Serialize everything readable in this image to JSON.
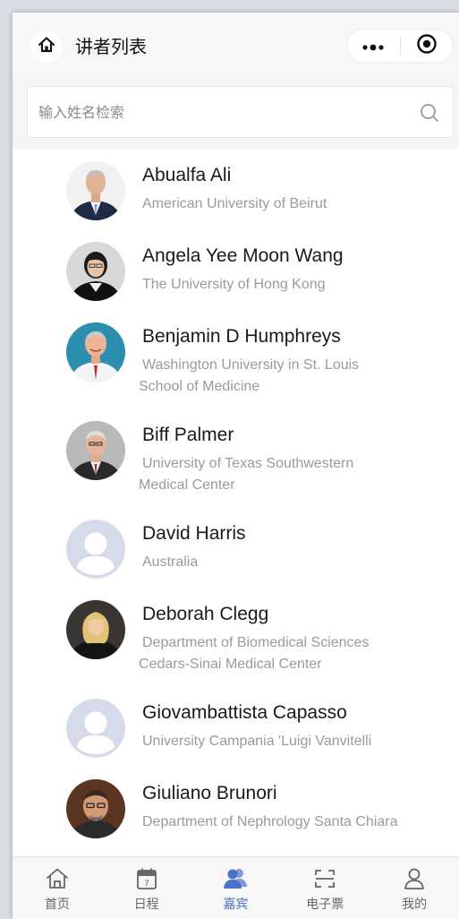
{
  "header": {
    "title": "讲者列表",
    "home_icon": "home-icon",
    "more_icon": "more-dots-icon",
    "close_icon": "target-close-icon"
  },
  "search": {
    "placeholder": "输入姓名检索",
    "value": "",
    "icon": "search-icon"
  },
  "speakers": [
    {
      "name": "Abualfa Ali",
      "affiliation": [
        "American University of Beirut"
      ],
      "avatar": "photo"
    },
    {
      "name": "Angela Yee Moon Wang",
      "affiliation": [
        "The University of Hong Kong"
      ],
      "avatar": "photo"
    },
    {
      "name": "Benjamin D Humphreys",
      "affiliation": [
        "Washington University in St. Louis",
        "School of Medicine"
      ],
      "avatar": "photo"
    },
    {
      "name": "Biff Palmer",
      "affiliation": [
        "University of Texas Southwestern",
        "Medical Center"
      ],
      "avatar": "photo"
    },
    {
      "name": "David Harris",
      "affiliation": [
        "Australia"
      ],
      "avatar": "placeholder"
    },
    {
      "name": "Deborah Clegg",
      "affiliation": [
        "Department of Biomedical Sciences",
        "Cedars-Sinai Medical Center"
      ],
      "avatar": "photo"
    },
    {
      "name": "Giovambattista Capasso",
      "affiliation": [
        "University Campania 'Luigi Vanvitelli"
      ],
      "avatar": "placeholder"
    },
    {
      "name": "Giuliano Brunori",
      "affiliation": [
        "Department of Nephrology Santa Chiara"
      ],
      "avatar": "photo"
    }
  ],
  "tabs": [
    {
      "label": "首页",
      "icon": "home-outline-icon",
      "active": false
    },
    {
      "label": "日程",
      "icon": "calendar-icon",
      "active": false
    },
    {
      "label": "嘉宾",
      "icon": "guests-icon",
      "active": true
    },
    {
      "label": "电子票",
      "icon": "ticket-scan-icon",
      "active": false
    },
    {
      "label": "我的",
      "icon": "profile-icon",
      "active": false
    }
  ],
  "colors": {
    "accent": "#4a72c8",
    "placeholder_avatar_bg": "#d6dbec",
    "placeholder_avatar_fg": "#ffffff"
  }
}
